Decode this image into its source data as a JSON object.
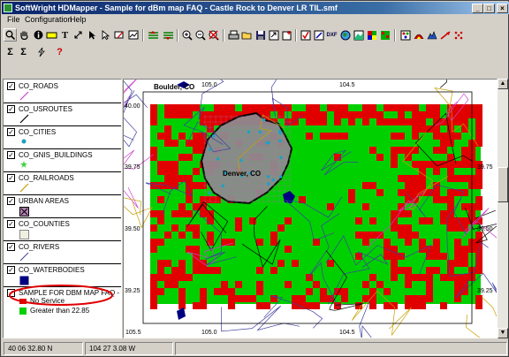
{
  "window": {
    "title": "SoftWright HDMapper - Sample for dBm map FAQ - Castle Rock to Denver LR TIL.smf"
  },
  "menu": [
    "File",
    "Configuration",
    "Help"
  ],
  "layers": [
    {
      "label": "CO_ROADS",
      "symbol": "roads"
    },
    {
      "label": "CO_USROUTES",
      "symbol": "usroutes"
    },
    {
      "label": "CO_CITIES",
      "symbol": "cities"
    },
    {
      "label": "CO_GNIS_BUILDINGS",
      "symbol": "buildings"
    },
    {
      "label": "CO_RAILROADS",
      "symbol": "railroads"
    },
    {
      "label": "URBAN AREAS",
      "symbol": "urban"
    },
    {
      "label": "CO_COUNTIES",
      "symbol": "counties"
    },
    {
      "label": "CO_RIVERS",
      "symbol": "rivers"
    },
    {
      "label": "CO_WATERBODIES",
      "symbol": "water"
    },
    {
      "label": "SAMPLE FOR DBM MAP FAQ - CAS",
      "symbol": "none"
    }
  ],
  "legend": [
    {
      "label": "No Service",
      "color": "#e00000"
    },
    {
      "label": "Greater than 22.85",
      "color": "#00d000"
    }
  ],
  "map": {
    "places": [
      "Boulder, CO",
      "Denver, CO"
    ],
    "top_ticks": [
      "105.0",
      "104.5"
    ],
    "bottom_ticks": [
      "105.5",
      "105.0",
      "104.5"
    ],
    "left_ticks": [
      "40.00",
      "39.75",
      "39.50",
      "39.25"
    ],
    "right_ticks": [
      "39.75",
      "39.50",
      "39.25"
    ]
  },
  "status": {
    "lat": "40 06 32.80 N",
    "lon": "104 27 3.08 W"
  },
  "colors": {
    "no_service": "#e00000",
    "service": "#00d000",
    "urban": "#8c8c8c",
    "water": "#000080"
  }
}
